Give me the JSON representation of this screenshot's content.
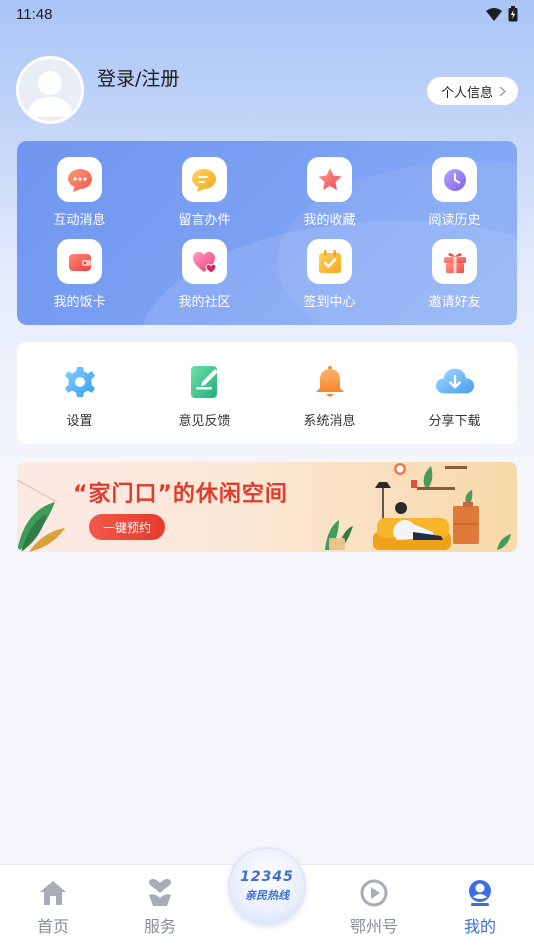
{
  "status": {
    "time": "11:48"
  },
  "profile": {
    "login_label": "登录/注册",
    "info_button_label": "个人信息"
  },
  "quick_menu": {
    "items": [
      {
        "label": "互动消息",
        "icon": "chat-bubble-icon",
        "color": "#f06b5a"
      },
      {
        "label": "留言办件",
        "icon": "message-pen-icon",
        "color": "#f7b731"
      },
      {
        "label": "我的收藏",
        "icon": "star-icon",
        "color": "#f46a6a"
      },
      {
        "label": "阅读历史",
        "icon": "clock-icon",
        "color": "#8f7cf0"
      },
      {
        "label": "我的饭卡",
        "icon": "wallet-icon",
        "color": "#f05a5a"
      },
      {
        "label": "我的社区",
        "icon": "heart-icon",
        "color": "#ef5a8a"
      },
      {
        "label": "签到中心",
        "icon": "calendar-check-icon",
        "color": "#f7b731"
      },
      {
        "label": "邀请好友",
        "icon": "gift-icon",
        "color": "#f26b6b"
      }
    ]
  },
  "settings_menu": {
    "items": [
      {
        "label": "设置",
        "icon": "gear-icon",
        "color": "#4fb6f0"
      },
      {
        "label": "意见反馈",
        "icon": "feedback-icon",
        "color": "#3dc48c"
      },
      {
        "label": "系统消息",
        "icon": "bell-icon",
        "color": "#f7913d"
      },
      {
        "label": "分享下载",
        "icon": "cloud-download-icon",
        "color": "#5aaef0"
      }
    ]
  },
  "banner": {
    "title": "“家门口”的休闲空间",
    "button_label": "一键预约"
  },
  "tabbar": {
    "tabs": [
      {
        "label": "首页",
        "icon": "home-icon"
      },
      {
        "label": "服务",
        "icon": "service-icon"
      },
      {
        "label": "鄂州号",
        "icon": "channel-icon"
      },
      {
        "label": "我的",
        "icon": "profile-icon"
      }
    ],
    "active_tab": "我的",
    "hotline_number": "12345",
    "hotline_text": "亲民热线"
  },
  "colors": {
    "accent": "#3a6fe3",
    "card_blue": "#7ca1f3",
    "inactive_tab": "#8a8f99"
  }
}
